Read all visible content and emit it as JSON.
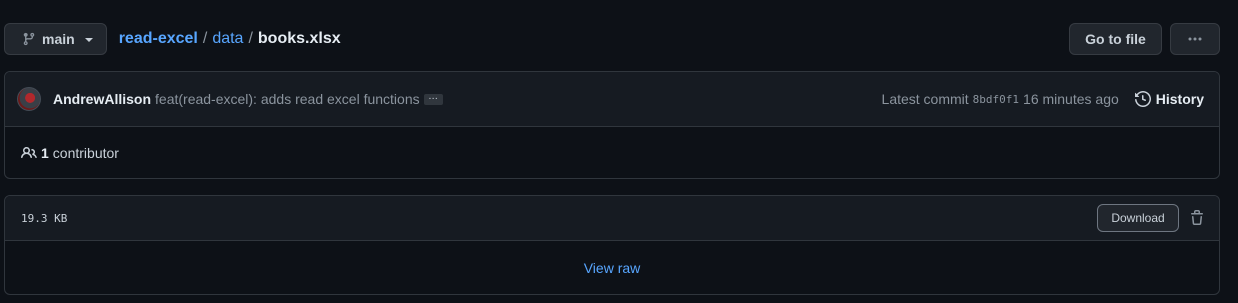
{
  "branch": {
    "name": "main",
    "icon": "git-branch-icon"
  },
  "breadcrumb": {
    "repo": "read-excel",
    "folder": "data",
    "file": "books.xlsx",
    "separator": "/"
  },
  "toolbar": {
    "goto_label": "Go to file",
    "more_label": "···"
  },
  "commit": {
    "author": "AndrewAllison",
    "message": "feat(read-excel): adds read excel functions",
    "ellipsis": "…",
    "latest_label": "Latest commit",
    "sha": "8bdf0f1",
    "time": "16 minutes ago",
    "history_label": "History"
  },
  "contributors": {
    "count": "1",
    "label": "contributor"
  },
  "file": {
    "size": "19.3 KB",
    "download_label": "Download",
    "view_raw_label": "View raw"
  },
  "colors": {
    "background": "#0d1117",
    "link": "#58a6ff",
    "border": "#30363d"
  }
}
